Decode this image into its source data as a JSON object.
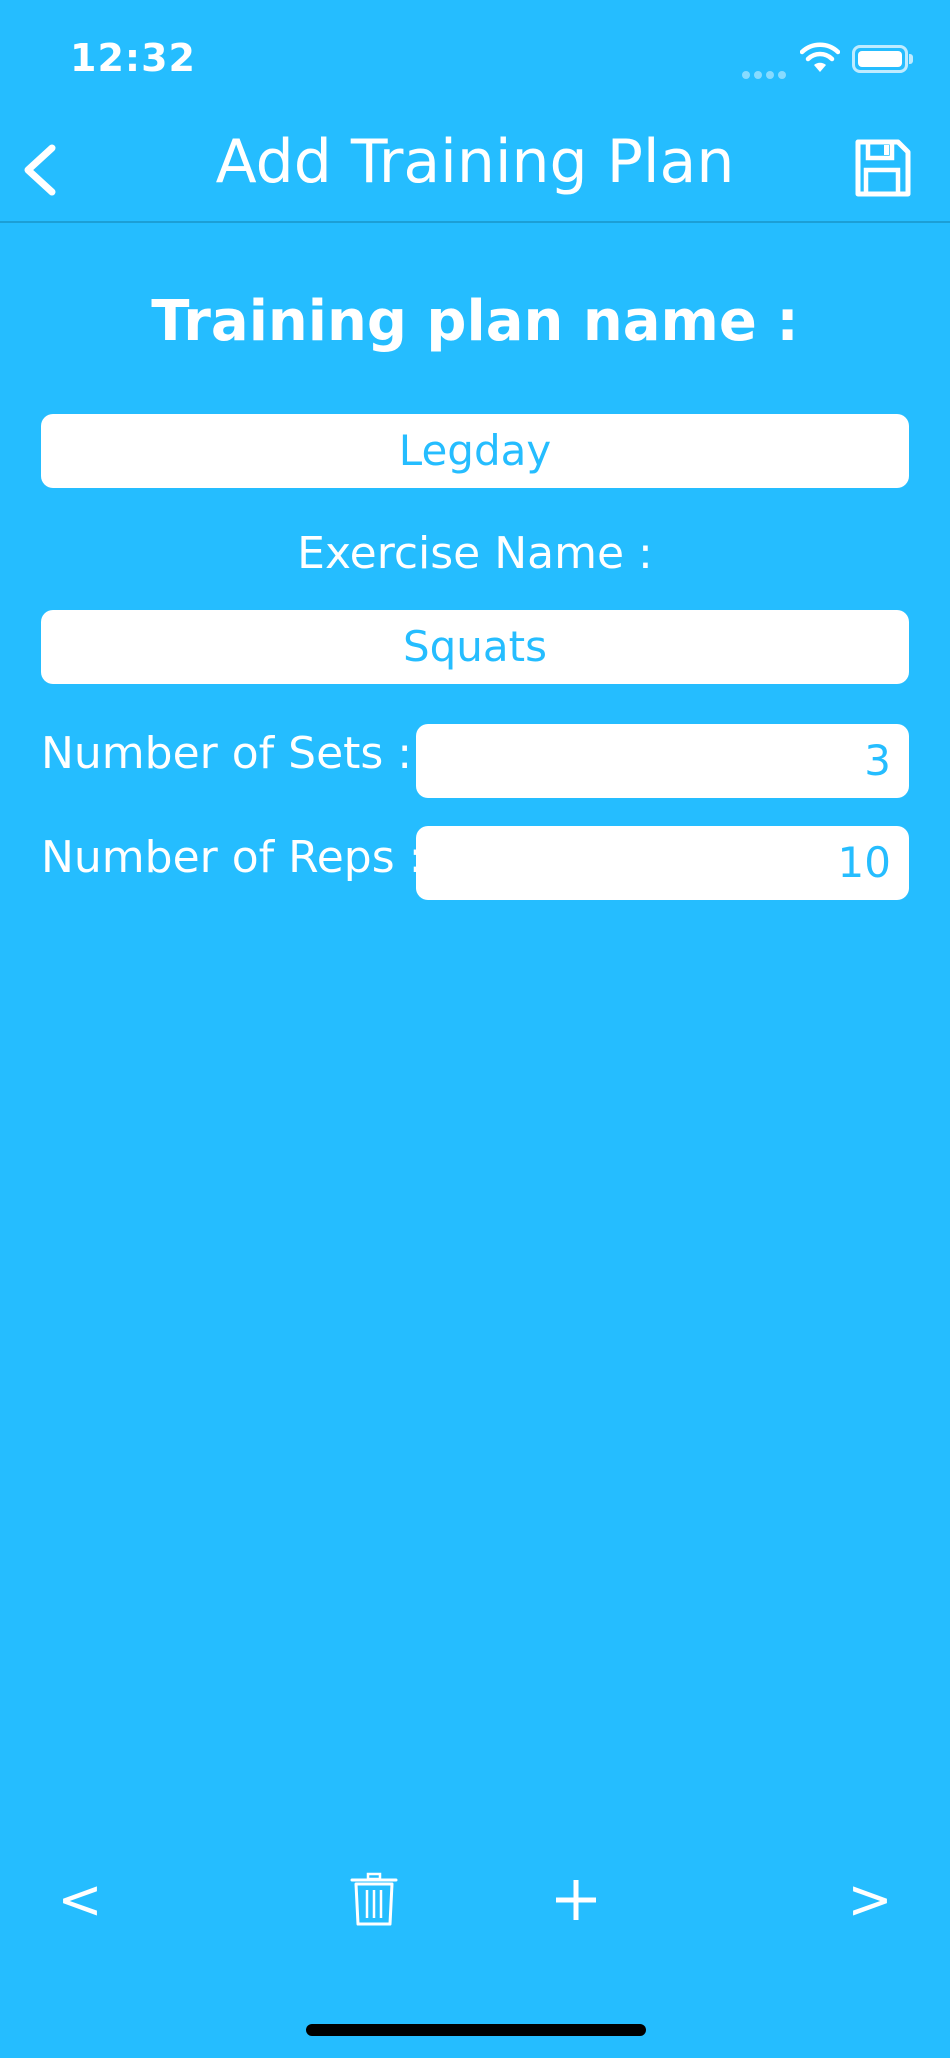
{
  "status_bar": {
    "time": "12:32"
  },
  "nav": {
    "title": "Add Training Plan",
    "back_icon": "chevron-left-icon",
    "save_icon": "floppy-disk-icon"
  },
  "form": {
    "plan_name_label": "Training plan name :",
    "plan_name_value": "Legday",
    "exercise_name_label": "Exercise Name :",
    "exercise_name_value": "Squats",
    "sets_label": "Number of Sets :",
    "sets_value": "3",
    "reps_label": "Number of Reps :",
    "reps_value": "10"
  },
  "toolbar": {
    "previous_label": "<",
    "next_label": ">",
    "delete_icon": "trash-icon",
    "add_icon": "plus-icon"
  },
  "colors": {
    "background": "#25bdff",
    "field_background": "#ffffff",
    "field_text": "#25bdff"
  }
}
